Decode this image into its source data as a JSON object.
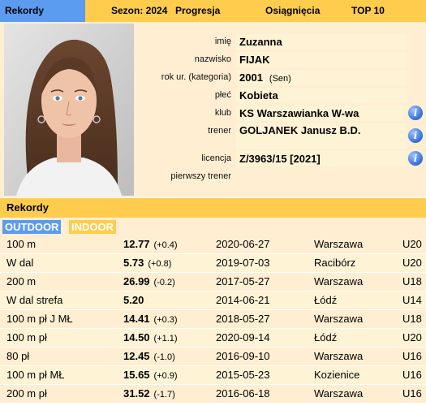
{
  "tabs": [
    {
      "label": "Rekordy",
      "active": true
    },
    {
      "label": "Sezon: 2024"
    },
    {
      "label": "Progresja"
    },
    {
      "label": "Osiągnięcia"
    },
    {
      "label": "TOP 10"
    }
  ],
  "profile": {
    "fields": [
      {
        "label": "imię",
        "value": "Zuzanna"
      },
      {
        "label": "nazwisko",
        "value": "FIJAK"
      },
      {
        "label": "rok ur. (kategoria)",
        "value": "2001",
        "extra": "(Sen)"
      },
      {
        "label": "płeć",
        "value": "Kobieta"
      },
      {
        "label": "klub",
        "value": "KS Warszawianka W-wa",
        "info": true
      },
      {
        "label": "trener",
        "value": "GOLJANEK Janusz B.D.",
        "info": true
      },
      {
        "label": "licencja",
        "value": "Z/3963/15 [2021]",
        "info": true
      },
      {
        "label": "pierwszy trener",
        "value": ""
      }
    ]
  },
  "records": {
    "title": "Rekordy",
    "subtabs": {
      "outdoor": "OUTDOOR",
      "indoor": "INDOOR"
    },
    "rows": [
      {
        "event": "100 m",
        "result": "12.77",
        "wind": "(+0.4)",
        "date": "2020-06-27",
        "place": "Warszawa",
        "cat": "U20"
      },
      {
        "event": "W dal",
        "result": "5.73",
        "wind": "(+0.8)",
        "date": "2019-07-03",
        "place": "Racibórz",
        "cat": "U20"
      },
      {
        "event": "200 m",
        "result": "26.99",
        "wind": "(-0.2)",
        "date": "2017-05-27",
        "place": "Warszawa",
        "cat": "U18"
      },
      {
        "event": "W dal strefa",
        "result": "5.20",
        "wind": "",
        "date": "2014-06-21",
        "place": "Łódź",
        "cat": "U14"
      },
      {
        "event": "100 m pł J MŁ",
        "result": "14.41",
        "wind": "(+0.3)",
        "date": "2018-05-27",
        "place": "Warszawa",
        "cat": "U18"
      },
      {
        "event": "100 m pł",
        "result": "14.50",
        "wind": "(+1.1)",
        "date": "2020-09-14",
        "place": "Łódź",
        "cat": "U20"
      },
      {
        "event": "80 pł",
        "result": "12.45",
        "wind": "(-1.0)",
        "date": "2016-09-10",
        "place": "Warszawa",
        "cat": "U16"
      },
      {
        "event": "100 m pł MŁ",
        "result": "15.65",
        "wind": "(+0.9)",
        "date": "2015-05-23",
        "place": "Kozienice",
        "cat": "U16"
      },
      {
        "event": "200 m pł",
        "result": "31.52",
        "wind": "(-1.7)",
        "date": "2016-06-18",
        "place": "Warszawa",
        "cat": "U16"
      }
    ]
  }
}
